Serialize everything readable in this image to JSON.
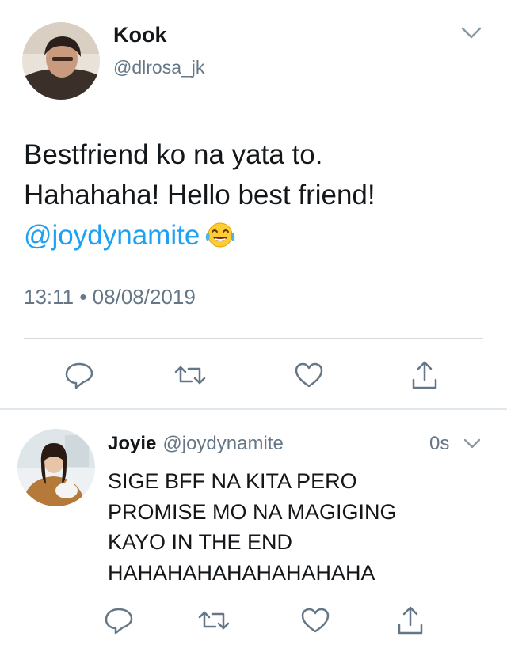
{
  "main_tweet": {
    "author_name": "Kook",
    "author_handle": "@dlrosa_jk",
    "text_lines": [
      "Bestfriend ko na yata to.",
      "Hahahaha! Hello best friend!"
    ],
    "mention": "@joydynamite",
    "emoji": "face-with-tears-of-joy",
    "timestamp": "13:11 • 08/08/2019",
    "actions": [
      "reply-icon",
      "retweet-icon",
      "like-icon",
      "share-icon"
    ]
  },
  "reply_tweet": {
    "author_name": "Joyie",
    "author_handle": "@joydynamite",
    "time": "0s",
    "text_lines": [
      "SIGE BFF NA KITA PERO",
      "PROMISE MO NA MAGIGING",
      "KAYO IN THE END",
      "HAHAHAHAHAHAHAHAHA"
    ],
    "actions": [
      "reply-icon",
      "retweet-icon",
      "like-icon",
      "share-icon"
    ]
  },
  "colors": {
    "text": "#14171a",
    "secondary": "#657786",
    "link": "#1da1f2",
    "divider": "#e1e8ed"
  }
}
